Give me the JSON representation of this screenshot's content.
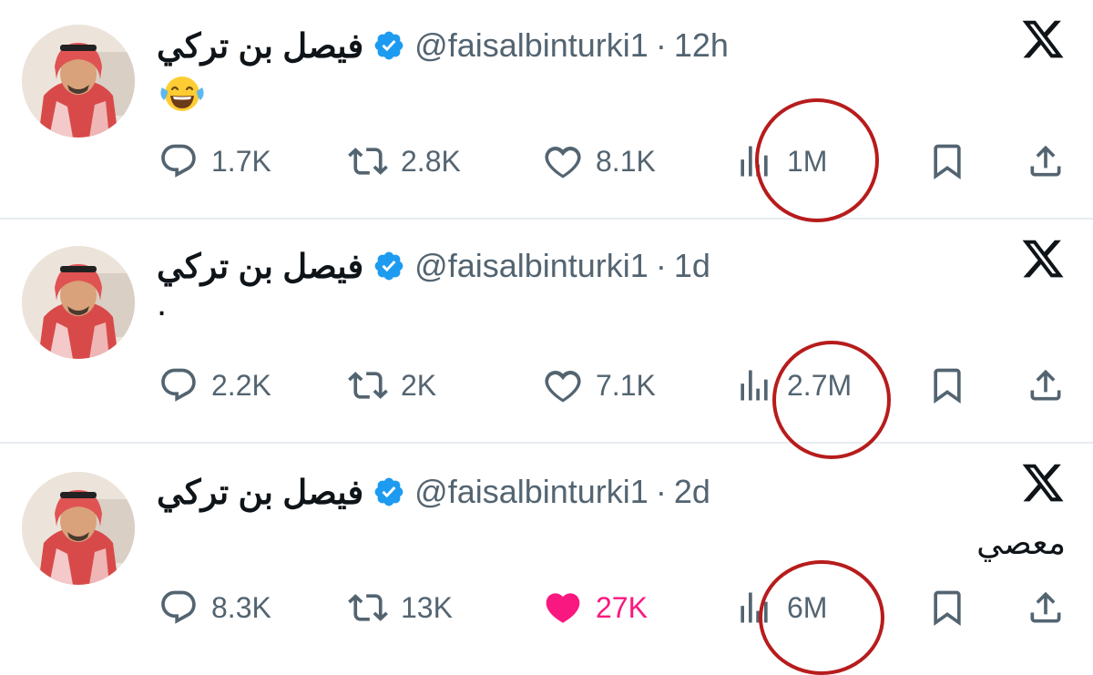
{
  "tweets": [
    {
      "name": "فيصل بن تركي",
      "handle": "@faisalbinturki1",
      "separator": "·",
      "time": "12h",
      "body_icon": "face-with-tears-of-joy-emoji",
      "body_text": "",
      "replies": "1.7K",
      "retweets": "2.8K",
      "likes": "8.1K",
      "liked": false,
      "views": "1M"
    },
    {
      "name": "فيصل بن تركي",
      "handle": "@faisalbinturki1",
      "separator": "·",
      "time": "1d",
      "body_text": ".",
      "replies": "2.2K",
      "retweets": "2K",
      "likes": "7.1K",
      "liked": false,
      "views": "2.7M"
    },
    {
      "name": "فيصل بن تركي",
      "handle": "@faisalbinturki1",
      "separator": "·",
      "time": "2d",
      "body_text": "معصي",
      "replies": "8.3K",
      "retweets": "13K",
      "likes": "27K",
      "liked": true,
      "views": "6M"
    }
  ],
  "icons": {
    "reply": "speech-bubble-icon",
    "retweet": "retweet-icon",
    "like": "heart-icon",
    "views": "bar-chart-icon",
    "bookmark": "bookmark-icon",
    "share": "share-upload-icon",
    "verified": "verified-badge-icon",
    "brand": "x-logo-icon"
  },
  "colors": {
    "text": "#0f1419",
    "muted": "#536471",
    "verified": "#1d9bf0",
    "liked": "#f91880",
    "annotation_circle": "#b71c1c",
    "divider": "#e6ecf0"
  }
}
